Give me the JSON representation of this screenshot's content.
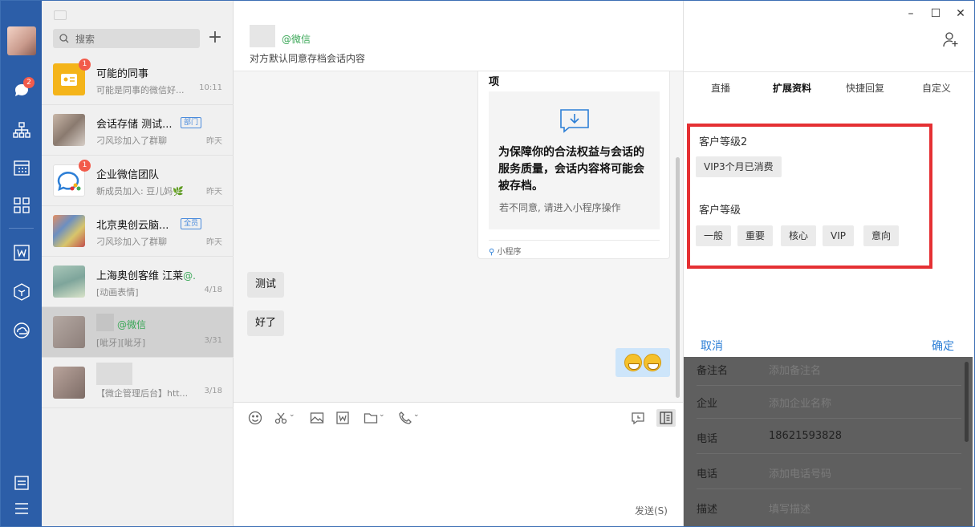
{
  "sidebar": {
    "chat_badge": "2"
  },
  "list": {
    "search_label": "搜索",
    "conversations": [
      {
        "title": "可能的同事",
        "sub": "可能是同事的微信好...",
        "time": "10:11",
        "badge": "1",
        "tag": ""
      },
      {
        "title": "会话存储 测试...",
        "sub": "刁风珍加入了群聊",
        "time": "昨天",
        "badge": "",
        "tag": "部门"
      },
      {
        "title": "企业微信团队",
        "sub": "新成员加入: 豆儿妈🌿",
        "time": "昨天",
        "badge": "1",
        "tag": ""
      },
      {
        "title": "北京奥创云脑...",
        "sub": "刁风珍加入了群聊",
        "time": "昨天",
        "badge": "",
        "tag": "全员"
      },
      {
        "title": "上海奥创客维 江莱",
        "title_suffix": "@...",
        "sub": "[动画表情]",
        "time": "4/18",
        "badge": "",
        "tag": ""
      },
      {
        "title": "",
        "title_suffix": "@微信",
        "sub": "[呲牙][呲牙]",
        "time": "3/31",
        "badge": "",
        "tag": ""
      },
      {
        "title": "",
        "sub": "【微企管理后台】htt...",
        "time": "3/18",
        "badge": "",
        "tag": ""
      }
    ]
  },
  "chat": {
    "contact_suffix": "@微信",
    "contact_note": "对方默认同意存档会话内容",
    "card": {
      "top_text": "项",
      "headline": "为保障你的合法权益与会话的服务质量，会话内容将可能会被存档。",
      "note": "若不同意, 请进入小程序操作",
      "footer": "小程序"
    },
    "messages": [
      "测试",
      "好了"
    ],
    "send_label": "发送(S)"
  },
  "panel": {
    "tabs": [
      "直播",
      "扩展资料",
      "快捷回复",
      "自定义"
    ],
    "active_tab": "扩展资料",
    "group1": {
      "title": "客户等级2",
      "chips": [
        "VIP3个月已消费"
      ]
    },
    "group2": {
      "title": "客户等级",
      "chips": [
        "一般",
        "重要",
        "核心",
        "VIP",
        "意向"
      ]
    },
    "cancel_label": "取消",
    "confirm_label": "确定",
    "details": [
      {
        "key": "备注名",
        "value": "添加备注名"
      },
      {
        "key": "企业",
        "value": "添加企业名称"
      },
      {
        "key": "电话",
        "value": "18621593828"
      },
      {
        "key": "电话",
        "value": "添加电话号码"
      },
      {
        "key": "描述",
        "value": "填写描述"
      }
    ]
  },
  "colors": {
    "sidebar": "#2c5ea8",
    "highlight": "#e53033",
    "link": "#2d7fd6",
    "badge": "#f25b4b"
  }
}
